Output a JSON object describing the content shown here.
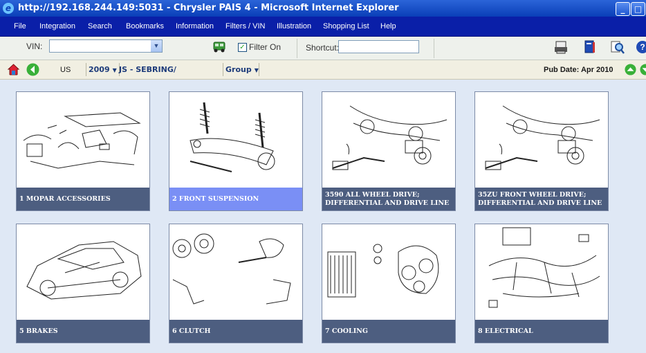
{
  "window": {
    "title": "http://192.168.244.149:5031 - Chrysler PAIS 4 - Microsoft Internet Explorer"
  },
  "menu": [
    "File",
    "Integration",
    "Search",
    "Bookmarks",
    "Information",
    "Filters / VIN",
    "Illustration",
    "Shopping List",
    "Help"
  ],
  "toolbar": {
    "vin_label": "VIN:",
    "vin_value": "",
    "filter_label": "Filter On",
    "filter_checked": true,
    "shortcut_label": "Shortcut:",
    "shortcut_value": ""
  },
  "nav": {
    "region": "US",
    "year": "2009",
    "model": "JS - SEBRING/ AVENGER",
    "group": "Group",
    "pub_date": "Pub Date: Apr 2010"
  },
  "groups": [
    {
      "label": "1 MOPAR ACCESSORIES",
      "icon": "accessories-diagram-icon",
      "selected": false
    },
    {
      "label": "2 FRONT SUSPENSION",
      "icon": "suspension-diagram-icon",
      "selected": true
    },
    {
      "label": "3590 ALL WHEEL DRIVE; DIFFERENTIAL AND DRIVE LINE",
      "icon": "driveline-diagram-icon",
      "selected": false
    },
    {
      "label": "35ZU FRONT WHEEL DRIVE; DIFFERENTIAL AND DRIVE LINE",
      "icon": "driveline-diagram-icon",
      "selected": false
    },
    {
      "label": "5 BRAKES",
      "icon": "car-brakes-diagram-icon",
      "selected": false
    },
    {
      "label": "6 CLUTCH",
      "icon": "clutch-diagram-icon",
      "selected": false
    },
    {
      "label": "7 COOLING",
      "icon": "cooling-diagram-icon",
      "selected": false
    },
    {
      "label": "8 ELECTRICAL",
      "icon": "wiring-diagram-icon",
      "selected": false
    }
  ],
  "colors": {
    "menubar": "#0a1fa8",
    "caption": "#4d5e80",
    "caption_selected": "#7a8ff5",
    "background": "#dfe8f5"
  }
}
